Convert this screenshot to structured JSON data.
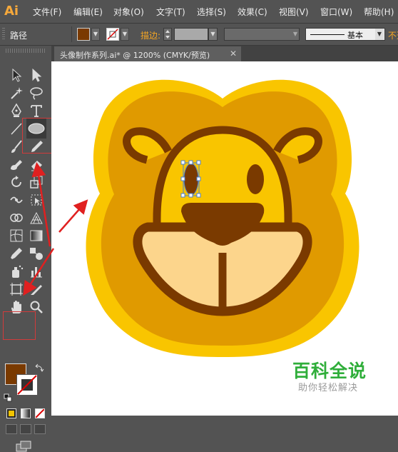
{
  "app": {
    "logo": "Ai"
  },
  "menu": [
    "文件(F)",
    "编辑(E)",
    "对象(O)",
    "文字(T)",
    "选择(S)",
    "效果(C)",
    "视图(V)",
    "窗口(W)",
    "帮助(H)"
  ],
  "control_bar": {
    "selection_label": "路径",
    "fill_color": "#7a3a00",
    "stroke_label": "描边:",
    "brush_label": "基本",
    "opacity_label": "不透"
  },
  "document": {
    "tab_title": "头像制作系列.ai* @ 1200% (CMYK/预览)",
    "close": "✕"
  },
  "toolbox": {
    "fill_color": "#7a3a00",
    "stroke_color": "#ffffff"
  },
  "artwork": {
    "colors": {
      "outer": "#f9c500",
      "inner": "#e09a00",
      "face": "#f9c500",
      "outline": "#7a3a00",
      "muzzle": "#fcd58c"
    }
  },
  "watermark": {
    "title": "百科全说",
    "subtitle": "助你轻松解决"
  },
  "colors": {
    "ui_bg": "#535353",
    "accent_orange": "#f5a623",
    "highlight_red": "#d23b3b"
  }
}
